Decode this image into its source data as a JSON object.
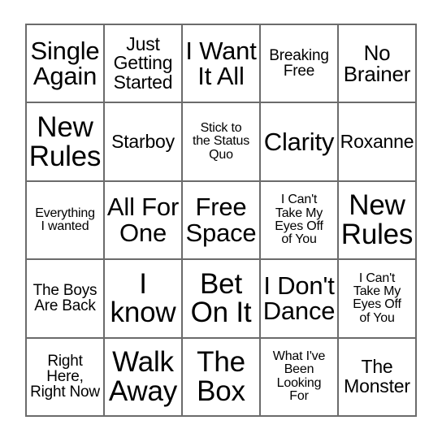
{
  "card": {
    "type": "bingo-card",
    "grid_size": "5x5",
    "border_color": "#6b6b6b",
    "cell_background": "#ffffff",
    "text_color": "#000000",
    "rows": [
      [
        {
          "text": "Single\nAgain",
          "size": "fs-xl"
        },
        {
          "text": "Just\nGetting\nStarted",
          "size": "fs-m"
        },
        {
          "text": "I Want\nIt All",
          "size": "fs-xl"
        },
        {
          "text": "Breaking\nFree",
          "size": "fs-s"
        },
        {
          "text": "No\nBrainer",
          "size": "fs-l"
        }
      ],
      [
        {
          "text": "New\nRules",
          "size": "fs-xxl"
        },
        {
          "text": "Starboy",
          "size": "fs-m"
        },
        {
          "text": "Stick to\nthe Status\nQuo",
          "size": "fs-xs"
        },
        {
          "text": "Clarity",
          "size": "fs-xl"
        },
        {
          "text": "Roxanne",
          "size": "fs-m"
        }
      ],
      [
        {
          "text": "Everything\nI wanted",
          "size": "fs-xs"
        },
        {
          "text": "All For\nOne",
          "size": "fs-xl"
        },
        {
          "text": "Free\nSpace",
          "size": "fs-xl"
        },
        {
          "text": "I Can't\nTake My\nEyes Off\nof You",
          "size": "fs-xs"
        },
        {
          "text": "New\nRules",
          "size": "fs-xxl"
        }
      ],
      [
        {
          "text": "The Boys\nAre Back",
          "size": "fs-s"
        },
        {
          "text": "I\nknow",
          "size": "fs-xxl"
        },
        {
          "text": "Bet\nOn It",
          "size": "fs-xxl"
        },
        {
          "text": "I Don't\nDance",
          "size": "fs-xl"
        },
        {
          "text": "I Can't\nTake My\nEyes Off\nof You",
          "size": "fs-xs"
        }
      ],
      [
        {
          "text": "Right\nHere,\nRight Now",
          "size": "fs-s"
        },
        {
          "text": "Walk\nAway",
          "size": "fs-xxl"
        },
        {
          "text": "The\nBox",
          "size": "fs-xxl"
        },
        {
          "text": "What I've\nBeen\nLooking\nFor",
          "size": "fs-xs"
        },
        {
          "text": "The\nMonster",
          "size": "fs-m"
        }
      ]
    ]
  }
}
